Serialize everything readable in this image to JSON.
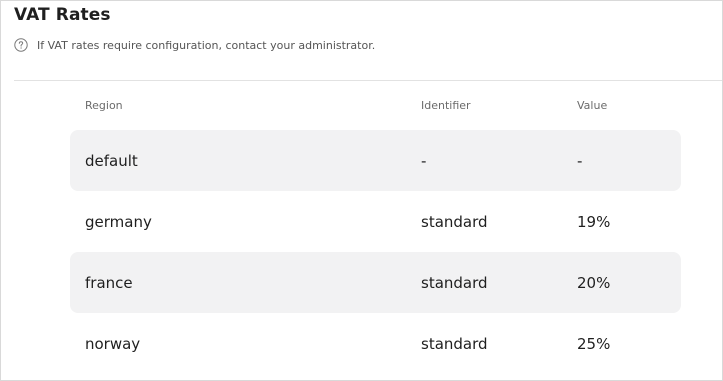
{
  "panel": {
    "title": "VAT Rates",
    "info_icon": "question-circle-icon",
    "info_text": "If VAT rates require configuration, contact your administrator."
  },
  "table": {
    "columns": [
      "Region",
      "Identifier",
      "Value"
    ],
    "rows": [
      {
        "region": "default",
        "identifier": "-",
        "value": "-",
        "shaded": true
      },
      {
        "region": "germany",
        "identifier": "standard",
        "value": "19%",
        "shaded": false
      },
      {
        "region": "france",
        "identifier": "standard",
        "value": "20%",
        "shaded": true
      },
      {
        "region": "norway",
        "identifier": "standard",
        "value": "25%",
        "shaded": false
      }
    ]
  },
  "colors": {
    "row_shade": "#f2f2f3",
    "border": "#d9d9d9",
    "text": "#1f1f1f",
    "muted": "#6b6b6b"
  }
}
